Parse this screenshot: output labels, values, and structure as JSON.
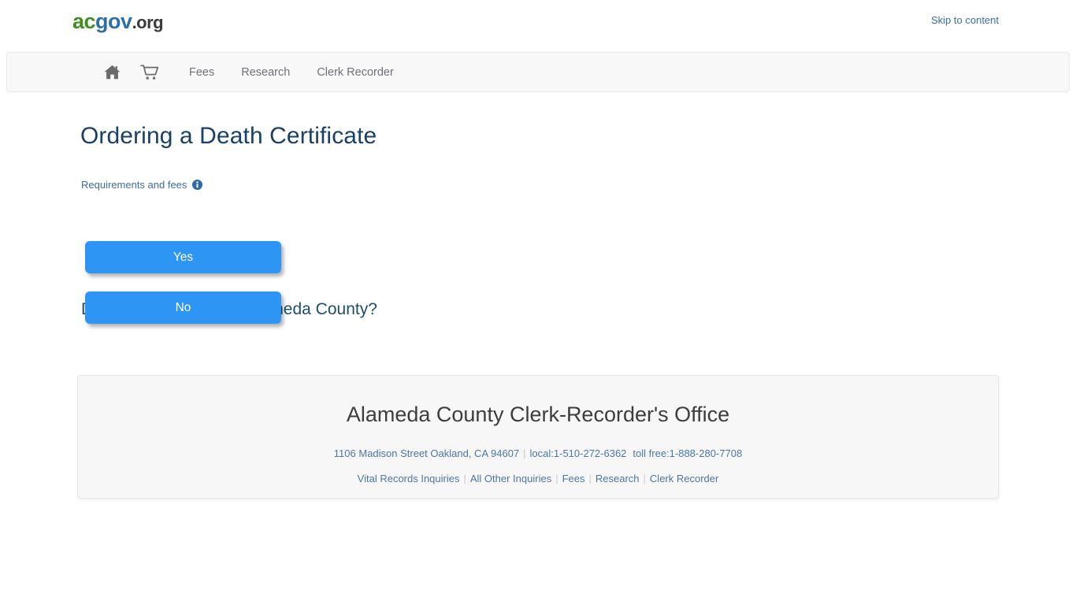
{
  "header": {
    "logo": {
      "part_green": "ac",
      "part_blue": "gov",
      "part_gray": ".org"
    },
    "skip_link": "Skip to content",
    "colors": {
      "logo_green": "#3f8e1f",
      "logo_blue": "#2f6fa8",
      "logo_gray": "#3b3b3b",
      "link_blue": "#3a6ea5"
    }
  },
  "nav": {
    "icons": [
      {
        "name": "home-icon",
        "label": "Home"
      },
      {
        "name": "cart-icon",
        "label": "Shopping Cart"
      }
    ],
    "links": [
      {
        "label": "Fees"
      },
      {
        "label": "Research"
      },
      {
        "label": "Clerk Recorder"
      }
    ]
  },
  "main": {
    "page_title": "Ordering a Death Certificate",
    "requirements_link": "Requirements and fees",
    "info_icon_name": "info-circle-icon",
    "question": "Did the death occur in Alameda County?",
    "buttons": [
      {
        "label": "Yes"
      },
      {
        "label": "No"
      }
    ],
    "button_color": "#2d96f5"
  },
  "footer": {
    "title": "Alameda County Clerk-Recorder's Office",
    "address": "1106 Madison Street Oakland, CA 94607",
    "local_phone": "local:1-510-272-6362",
    "toll_free_phone": "toll free:1-888-280-7708",
    "links": [
      {
        "label": "Vital Records Inquiries"
      },
      {
        "label": "All Other Inquiries"
      },
      {
        "label": "Fees"
      },
      {
        "label": "Research"
      },
      {
        "label": "Clerk Recorder"
      }
    ],
    "link_color": "#4a77a8"
  }
}
